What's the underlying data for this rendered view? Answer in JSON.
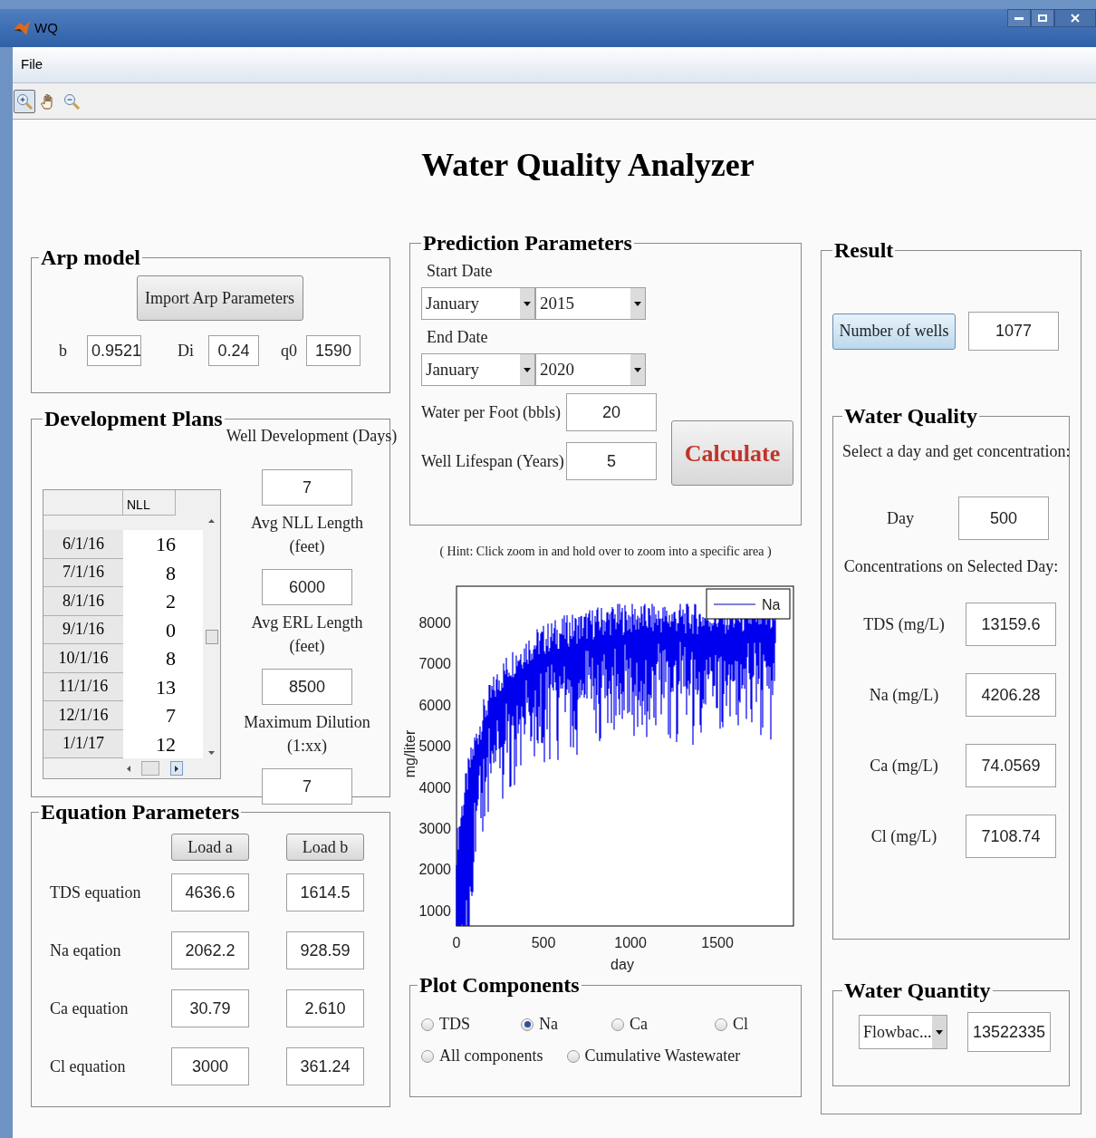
{
  "window": {
    "title": "WQ"
  },
  "menu": [
    "File"
  ],
  "toolbar": [
    {
      "kind": "zoom-in",
      "selected": true
    },
    {
      "kind": "pan",
      "selected": false
    },
    {
      "kind": "zoom-out",
      "selected": false
    }
  ],
  "heading": "Water Quality Analyzer",
  "arp_model": {
    "title": "Arp model",
    "button": "Import Arp Parameters",
    "fields": [
      {
        "label": "b",
        "value": "0.9521"
      },
      {
        "label": "Di",
        "value": "0.24"
      },
      {
        "label": "q0",
        "value": "1590"
      }
    ]
  },
  "development_plans": {
    "title": "Development Plans",
    "table": {
      "columns": [
        "NLL"
      ],
      "rows": [
        {
          "date": "6/1/16",
          "nll": "16"
        },
        {
          "date": "7/1/16",
          "nll": "8"
        },
        {
          "date": "8/1/16",
          "nll": "2"
        },
        {
          "date": "9/1/16",
          "nll": "0"
        },
        {
          "date": "10/1/16",
          "nll": "8"
        },
        {
          "date": "11/1/16",
          "nll": "13"
        },
        {
          "date": "12/1/16",
          "nll": "7"
        },
        {
          "date": "1/1/17",
          "nll": "12"
        }
      ]
    },
    "fields": [
      {
        "label": "Well Development (Days)",
        "value": "7"
      },
      {
        "label": "Avg NLL Length (feet)",
        "value": "6000"
      },
      {
        "label": "Avg ERL Length (feet)",
        "value": "8500"
      },
      {
        "label": "Maximum Dilution (1:xx)",
        "value": "7"
      }
    ]
  },
  "equation_parameters": {
    "title": "Equation Parameters",
    "buttons": [
      "Load a",
      "Load b"
    ],
    "rows": [
      {
        "label": "TDS equation",
        "a": "4636.6",
        "b": "1614.5"
      },
      {
        "label": "Na eqation",
        "a": "2062.2",
        "b": "928.59"
      },
      {
        "label": "Ca equation",
        "a": "30.79",
        "b": "2.610"
      },
      {
        "label": "Cl equation",
        "a": "3000",
        "b": "361.24"
      }
    ]
  },
  "prediction_parameters": {
    "title": "Prediction Parameters",
    "dates": [
      {
        "label": "Start Date",
        "month": "January",
        "year": "2015"
      },
      {
        "label": "End Date",
        "month": "January",
        "year": "2020"
      }
    ],
    "fields": [
      {
        "label": "Water per Foot (bbls)",
        "value": "20"
      },
      {
        "label": "Well Lifespan (Years)",
        "value": "5"
      }
    ],
    "button": "Calculate"
  },
  "hint": "( Hint: Click zoom in and hold over to zoom into a specific area )",
  "plot": {
    "ylabel": "mg/liter",
    "xlabel": "day",
    "yticks": [
      "8000",
      "7000",
      "6000",
      "5000",
      "4000",
      "3000",
      "2000",
      "1000"
    ],
    "xticks": [
      "0",
      "500",
      "1000",
      "1500"
    ],
    "legend": "Na"
  },
  "plot_components": {
    "title": "Plot Components",
    "options": [
      {
        "label": "TDS",
        "selected": false
      },
      {
        "label": "Na",
        "selected": true
      },
      {
        "label": "Ca",
        "selected": false
      },
      {
        "label": "Cl",
        "selected": false
      },
      {
        "label": "All components",
        "selected": false
      },
      {
        "label": "Cumulative Wastewater",
        "selected": false
      }
    ]
  },
  "result": {
    "title": "Result",
    "button": "Number of wells",
    "value": "1077",
    "water_quality": {
      "title": "Water Quality",
      "prompt": "Select a day and get concentration:",
      "day": {
        "label": "Day",
        "value": "500"
      },
      "subtitle": "Concentrations on Selected Day:",
      "rows": [
        {
          "label": "TDS (mg/L)",
          "value": "13159.6"
        },
        {
          "label": "Na (mg/L)",
          "value": "4206.28"
        },
        {
          "label": "Ca (mg/L)",
          "value": "74.0569"
        },
        {
          "label": "Cl (mg/L)",
          "value": "7108.74"
        }
      ]
    },
    "water_quantity": {
      "title": "Water Quantity",
      "select": "Flowbac...",
      "value": "13522335"
    }
  }
}
